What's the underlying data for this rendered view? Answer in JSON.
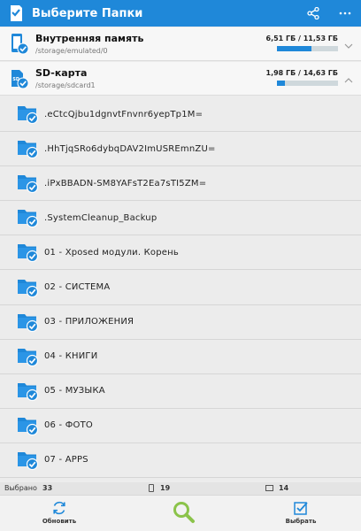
{
  "appbar": {
    "title": "Выберите Папки",
    "icons": {
      "app": "sd-card-check-icon",
      "share": "share-icon",
      "more": "more-vert-icon"
    }
  },
  "storages": [
    {
      "name": "Внутренняя память",
      "path": "/storage/emulated/0",
      "size": "6,51 ГБ / 11,53 ГБ",
      "used_fraction": 0.565,
      "icon": "phone-check-icon",
      "expanded": false
    },
    {
      "name": "SD-карта",
      "path": "/storage/sdcard1",
      "size": "1,98 ГБ / 14,63 ГБ",
      "used_fraction": 0.135,
      "icon": "sd-card-check-icon",
      "expanded": true
    }
  ],
  "folders": [
    {
      "name": ".eCtcQjbu1dgnvtFnvnr6yepTp1M="
    },
    {
      "name": ".HhTjqSRo6dybqDAV2ImUSREmnZU="
    },
    {
      "name": ".iPxBBADN-SM8YAFsT2Ea7sTI5ZM="
    },
    {
      "name": ".SystemCleanup_Backup"
    },
    {
      "name": "01 - Xposed модули. Корень"
    },
    {
      "name": "02 - СИСТЕМА"
    },
    {
      "name": "03 - ПРИЛОЖЕНИЯ"
    },
    {
      "name": "04 - КНИГИ"
    },
    {
      "name": "05 - МУЗЫКА"
    },
    {
      "name": "06 - ФОТО"
    },
    {
      "name": "07 - APPS"
    }
  ],
  "status": {
    "selected_label": "Выбрано",
    "selected_count": "33",
    "device_count": "19",
    "sd_count": "14"
  },
  "bottom": {
    "refresh_label": "Обновить",
    "select_label": "Выбрать"
  },
  "colors": {
    "accent": "#1f88d9",
    "search_icon": "#8bc34a"
  }
}
